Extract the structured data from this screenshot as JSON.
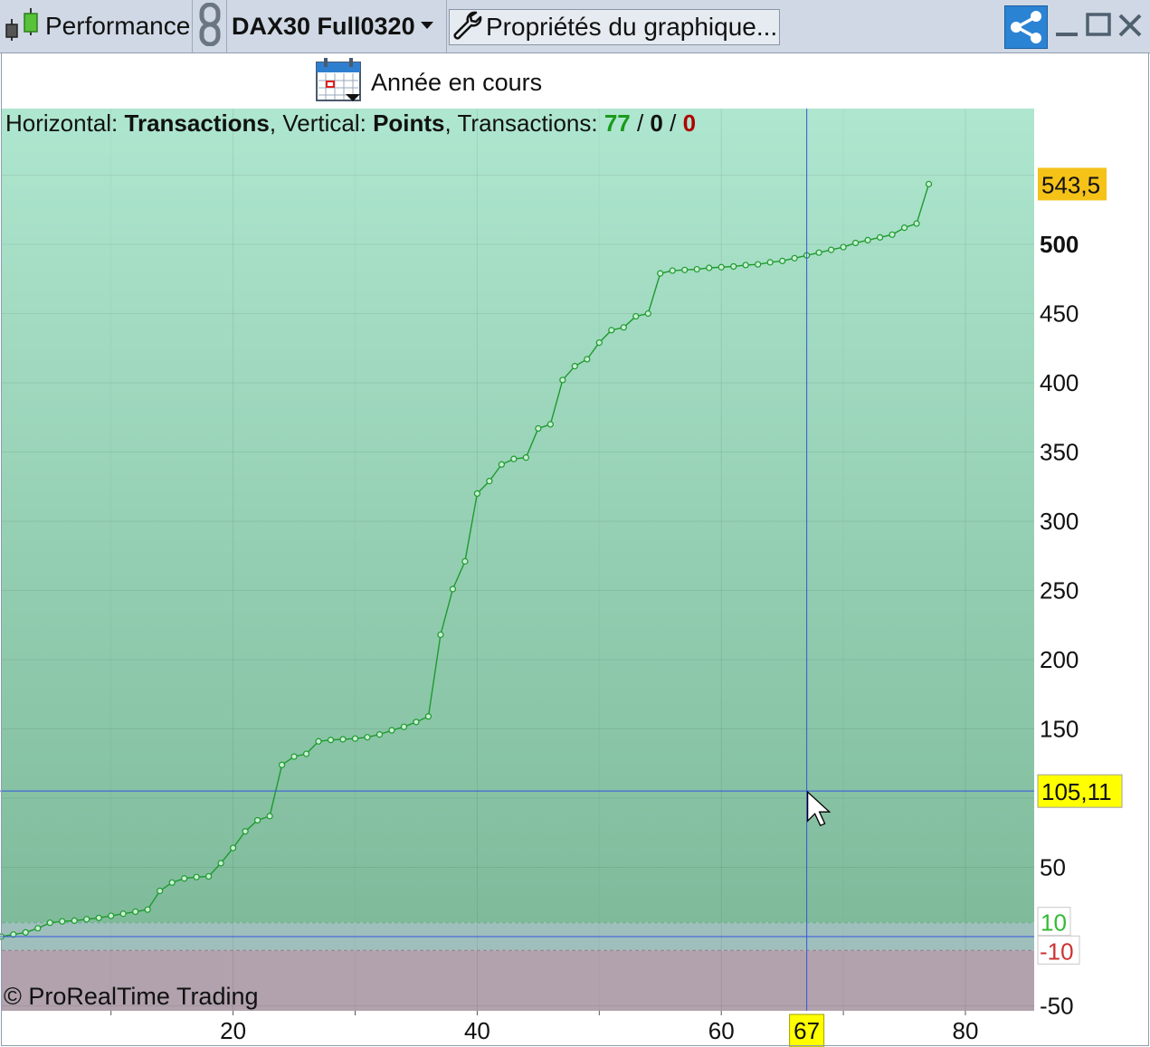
{
  "titlebar": {
    "window_title": "Performance",
    "symbol": "DAX30 Full0320",
    "properties_label": "Propriétés du graphique...",
    "icons": [
      "candlestick-icon",
      "link-icon",
      "dropdown-arrow-icon",
      "wrench-icon",
      "share-icon",
      "minimize-icon",
      "maximize-icon",
      "close-icon"
    ]
  },
  "period": {
    "label": "Année en cours",
    "icon": "calendar-icon"
  },
  "info": {
    "h_prefix": "Horizontal: ",
    "h_value": "Transactions",
    "v_prefix": ", Vertical: ",
    "v_value": "Points",
    "t_prefix": ", Transactions: ",
    "total": "77",
    "sep1": " / ",
    "mid": "0",
    "sep2": " / ",
    "losers": "0"
  },
  "copyright": "© ProRealTime Trading",
  "cursor": {
    "x_label": "67",
    "y_label": "105,11",
    "x": 67,
    "y": 105.11
  },
  "colors": {
    "line": "#1e9a2e",
    "bg_top": "#aee6cf",
    "bg_bottom": "#7fbb9b",
    "neg_zone": "#b1a2ad",
    "crosshair": "#3355dd",
    "last_value_badge": "#f5c218",
    "cursor_badge": "#ffff00",
    "upper_threshold": "#33bb33",
    "lower_threshold": "#cc3333"
  },
  "chart_data": {
    "type": "line",
    "xlabel": "",
    "ylabel": "",
    "xlim": [
      0,
      86
    ],
    "ylim": [
      -53,
      600
    ],
    "x_ticks": [
      "20",
      "40",
      "60",
      "80"
    ],
    "y_ticks": [
      "-50",
      "50",
      "150",
      "200",
      "250",
      "300",
      "350",
      "400",
      "450",
      "500"
    ],
    "y_tick_values": [
      -50,
      50,
      150,
      200,
      250,
      300,
      350,
      400,
      450,
      500
    ],
    "y_bold_tick": "500",
    "last_value_label": "543,5",
    "last_value": 543.5,
    "threshold_upper_label": "10",
    "threshold_upper": 10,
    "threshold_lower_label": "-10",
    "threshold_lower": -10,
    "grid": true,
    "series": [
      {
        "values": [
          [
            1,
            0
          ],
          [
            2,
            1.5
          ],
          [
            3,
            3
          ],
          [
            4,
            6
          ],
          [
            5,
            10
          ],
          [
            6,
            11
          ],
          [
            7,
            11.5
          ],
          [
            8,
            12.5
          ],
          [
            9,
            13.5
          ],
          [
            10,
            15
          ],
          [
            11,
            16.5
          ],
          [
            12,
            18
          ],
          [
            13,
            19.5
          ],
          [
            14,
            33
          ],
          [
            15,
            39
          ],
          [
            16,
            42
          ],
          [
            17,
            43
          ],
          [
            18,
            43.5
          ],
          [
            19,
            53
          ],
          [
            20,
            64
          ],
          [
            21,
            76
          ],
          [
            22,
            84
          ],
          [
            23,
            87
          ],
          [
            24,
            124
          ],
          [
            25,
            130
          ],
          [
            26,
            132
          ],
          [
            27,
            141
          ],
          [
            28,
            142
          ],
          [
            29,
            142.5
          ],
          [
            30,
            143
          ],
          [
            31,
            144
          ],
          [
            32,
            146
          ],
          [
            33,
            149
          ],
          [
            34,
            151.5
          ],
          [
            35,
            155
          ],
          [
            36,
            159
          ],
          [
            37,
            218
          ],
          [
            38,
            251
          ],
          [
            39,
            271
          ],
          [
            40,
            320
          ],
          [
            41,
            329
          ],
          [
            42,
            341
          ],
          [
            43,
            345
          ],
          [
            44,
            346
          ],
          [
            45,
            367
          ],
          [
            46,
            370
          ],
          [
            47,
            402
          ],
          [
            48,
            412
          ],
          [
            49,
            417
          ],
          [
            50,
            429
          ],
          [
            51,
            438
          ],
          [
            52,
            440
          ],
          [
            53,
            448
          ],
          [
            54,
            450
          ],
          [
            55,
            479
          ],
          [
            56,
            481
          ],
          [
            57,
            481.5
          ],
          [
            58,
            482
          ],
          [
            59,
            483
          ],
          [
            60,
            483.5
          ],
          [
            61,
            484
          ],
          [
            62,
            485
          ],
          [
            63,
            485.5
          ],
          [
            64,
            487
          ],
          [
            65,
            488
          ],
          [
            66,
            490
          ],
          [
            67,
            492
          ],
          [
            68,
            494
          ],
          [
            69,
            496
          ],
          [
            70,
            498
          ],
          [
            71,
            501
          ],
          [
            72,
            503
          ],
          [
            73,
            505
          ],
          [
            74,
            507
          ],
          [
            75,
            512
          ],
          [
            76,
            515
          ],
          [
            77,
            543.5
          ]
        ]
      }
    ]
  }
}
